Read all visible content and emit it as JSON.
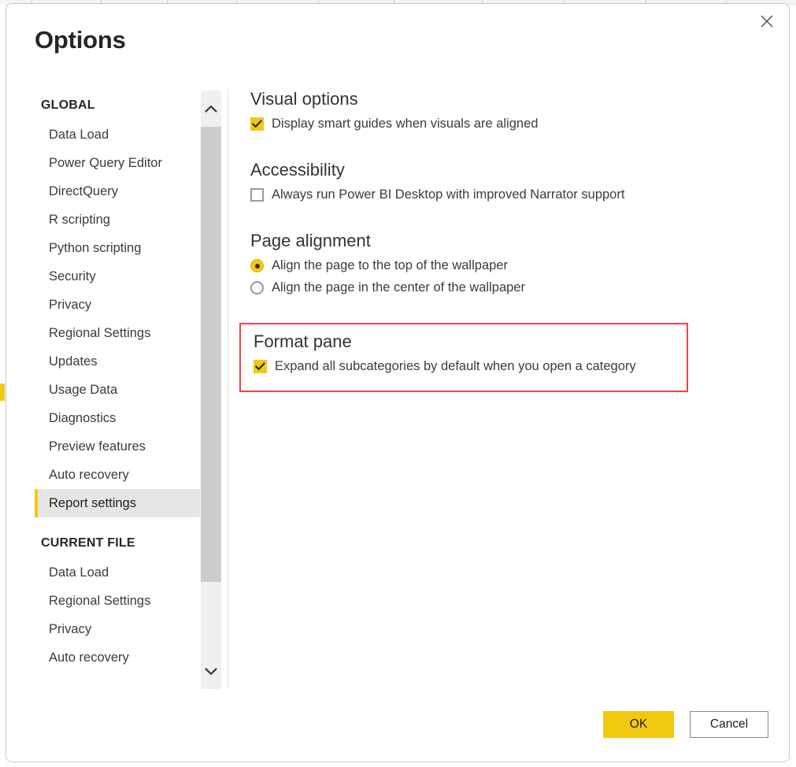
{
  "dialog": {
    "title": "Options",
    "close_label": "Close"
  },
  "sidebar": {
    "groups": [
      {
        "header": "GLOBAL",
        "items": [
          {
            "label": "Data Load",
            "selected": false
          },
          {
            "label": "Power Query Editor",
            "selected": false
          },
          {
            "label": "DirectQuery",
            "selected": false
          },
          {
            "label": "R scripting",
            "selected": false
          },
          {
            "label": "Python scripting",
            "selected": false
          },
          {
            "label": "Security",
            "selected": false
          },
          {
            "label": "Privacy",
            "selected": false
          },
          {
            "label": "Regional Settings",
            "selected": false
          },
          {
            "label": "Updates",
            "selected": false
          },
          {
            "label": "Usage Data",
            "selected": false
          },
          {
            "label": "Diagnostics",
            "selected": false
          },
          {
            "label": "Preview features",
            "selected": false
          },
          {
            "label": "Auto recovery",
            "selected": false
          },
          {
            "label": "Report settings",
            "selected": true
          }
        ]
      },
      {
        "header": "CURRENT FILE",
        "items": [
          {
            "label": "Data Load",
            "selected": false
          },
          {
            "label": "Regional Settings",
            "selected": false
          },
          {
            "label": "Privacy",
            "selected": false
          },
          {
            "label": "Auto recovery",
            "selected": false
          }
        ]
      }
    ],
    "scrollbar": {
      "up_icon": "chevron-up-icon",
      "down_icon": "chevron-down-icon"
    }
  },
  "content": {
    "visual_options": {
      "heading": "Visual options",
      "checkbox_label": "Display smart guides when visuals are aligned",
      "checked": true
    },
    "accessibility": {
      "heading": "Accessibility",
      "checkbox_label": "Always run Power BI Desktop with improved Narrator support",
      "checked": false
    },
    "page_alignment": {
      "heading": "Page alignment",
      "options": [
        {
          "label": "Align the page to the top of the wallpaper",
          "selected": true
        },
        {
          "label": "Align the page in the center of the wallpaper",
          "selected": false
        }
      ]
    },
    "format_pane": {
      "heading": "Format pane",
      "checkbox_label": "Expand all subcategories by default when you open a category",
      "checked": true,
      "highlighted": true
    }
  },
  "footer": {
    "ok_label": "OK",
    "cancel_label": "Cancel"
  },
  "colors": {
    "accent": "#F2C811",
    "highlight_border": "#EC4A43",
    "selected_row_bg": "#E6E6E6",
    "text": "#3B3B3B"
  }
}
